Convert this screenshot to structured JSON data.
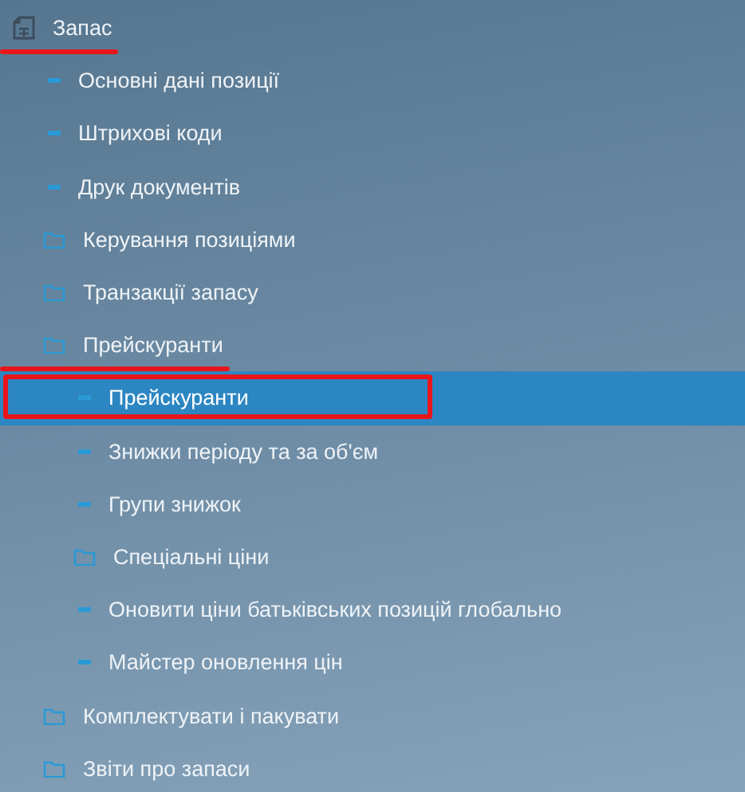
{
  "tree": [
    {
      "label": "Запас",
      "kind": "document",
      "selected": false,
      "underlined": true,
      "children": [
        {
          "label": "Основні дані позиції",
          "kind": "leaf",
          "selected": false
        },
        {
          "label": "Штрихові коди",
          "kind": "leaf",
          "selected": false
        },
        {
          "label": "Друк документів",
          "kind": "leaf",
          "selected": false
        },
        {
          "label": "Керування позиціями",
          "kind": "folder",
          "selected": false
        },
        {
          "label": "Транзакції запасу",
          "kind": "folder",
          "selected": false
        },
        {
          "label": "Прейскуранти",
          "kind": "folder",
          "selected": false,
          "underlined": true,
          "children": [
            {
              "label": "Прейскуранти",
              "kind": "leaf",
              "selected": true,
              "boxed": true
            },
            {
              "label": "Знижки періоду та за об'єм",
              "kind": "leaf",
              "selected": false
            },
            {
              "label": "Групи знижок",
              "kind": "leaf",
              "selected": false
            },
            {
              "label": "Спеціальні ціни",
              "kind": "folder",
              "selected": false
            },
            {
              "label": "Оновити ціни батьківських позицій глобально",
              "kind": "leaf",
              "selected": false
            },
            {
              "label": "Майстер оновлення цін",
              "kind": "leaf",
              "selected": false
            }
          ]
        },
        {
          "label": "Комплектувати і пакувати",
          "kind": "folder",
          "selected": false
        },
        {
          "label": "Звіти про запаси",
          "kind": "folder",
          "selected": false
        }
      ]
    }
  ]
}
